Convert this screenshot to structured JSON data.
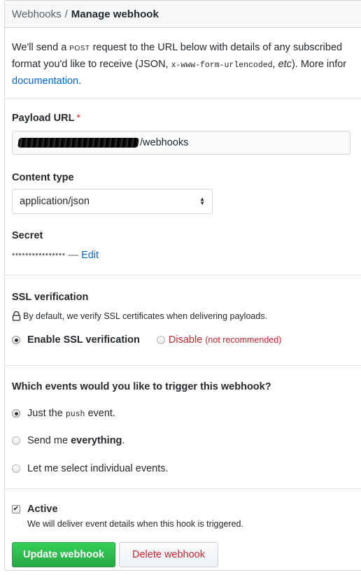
{
  "header": {
    "breadcrumb_parent": "Webhooks",
    "breadcrumb_separator": "/",
    "title": "Manage webhook"
  },
  "intro": {
    "line1_start": "We'll send a",
    "method": "POST",
    "line1_end": "request to the URL below with details of any subscribed",
    "line2_start": "format you'd like to receive (JSON,",
    "format_code": "x-www-form-urlencoded",
    "line2_sep": ",",
    "etc": "etc",
    "line2_end": "). More infor",
    "docs_link": "documentation",
    "docs_period": "."
  },
  "payload": {
    "label": "Payload URL",
    "required_mark": "*",
    "value_suffix": "/webhooks"
  },
  "content_type": {
    "label": "Content type",
    "selected": "application/json"
  },
  "secret": {
    "label": "Secret",
    "masked": "****************",
    "dash": "—",
    "edit_link": "Edit"
  },
  "ssl": {
    "label": "SSL verification",
    "description": "By default, we verify SSL certificates when delivering payloads.",
    "enable_label": "Enable SSL verification",
    "disable_label": "Disable",
    "disable_note": "(not recommended)",
    "selected": "enable"
  },
  "events": {
    "question": "Which events would you like to trigger this webhook?",
    "opt1_start": "Just the",
    "opt1_code": "push",
    "opt1_end": "event.",
    "opt2_start": "Send me",
    "opt2_bold": "everything",
    "opt2_end": ".",
    "opt3": "Let me select individual events.",
    "selected": "push"
  },
  "active": {
    "label": "Active",
    "description": "We will deliver event details when this hook is triggered.",
    "checked": true,
    "check_glyph": "✔"
  },
  "buttons": {
    "update": "Update webhook",
    "delete": "Delete webhook"
  },
  "colors": {
    "accent_link": "#0366d6",
    "danger": "#cb2431",
    "primary_green": "#28a745",
    "border": "#d1d5da"
  }
}
